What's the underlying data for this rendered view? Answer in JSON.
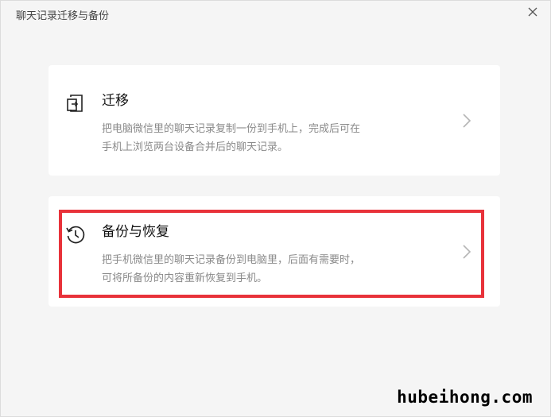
{
  "window": {
    "title": "聊天记录迁移与备份"
  },
  "cards": {
    "migrate": {
      "title": "迁移",
      "desc_line1": "把电脑微信里的聊天记录复制一份到手机上，完成后可在",
      "desc_line2": "手机上浏览两台设备合并后的聊天记录。",
      "icon": "migrate-icon"
    },
    "backup": {
      "title": "备份与恢复",
      "desc_line1": "把手机微信里的聊天记录备份到电脑里，后面有需要时，",
      "desc_line2": "可将所备份的内容重新恢复到手机。",
      "icon": "history-icon"
    }
  },
  "watermark": "hubeihong.com",
  "colors": {
    "highlight": "#e8323a",
    "background": "#f5f5f5",
    "card": "#ffffff"
  }
}
